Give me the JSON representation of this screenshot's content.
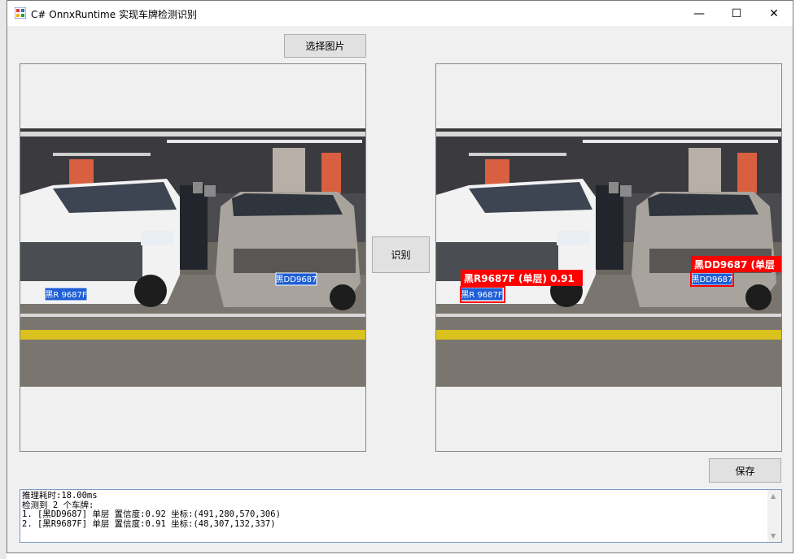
{
  "window": {
    "title": "C# OnnxRuntime  实现车牌检测识别",
    "controls": {
      "minimize": "—",
      "maximize": "☐",
      "close": "✕"
    }
  },
  "buttons": {
    "select_image": "选择图片",
    "recognize": "识别",
    "save": "保存"
  },
  "source_image": {
    "plates": [
      "黑R 9687F",
      "黑DD9687"
    ]
  },
  "result_image": {
    "plates": [
      "黑R 9687F",
      "黑DD9687"
    ],
    "detections": [
      {
        "label": "黑R9687F (单层) 0.91"
      },
      {
        "label": "黑DD9687 (单层"
      }
    ]
  },
  "log": {
    "lines": [
      "推理耗时:18.00ms",
      "检测到 2 个车牌:",
      "1. [黑DD9687] 单层 置信度:0.92 坐标:(491,280,570,306)",
      "2. [黑R9687F] 单层 置信度:0.91 坐标:(48,307,132,337)"
    ]
  },
  "colors": {
    "detection_box": "#ff0000",
    "plate_blue": "#1f5fd6"
  },
  "icons": [
    "app-icon",
    "scroll-up-icon",
    "scroll-down-icon"
  ]
}
